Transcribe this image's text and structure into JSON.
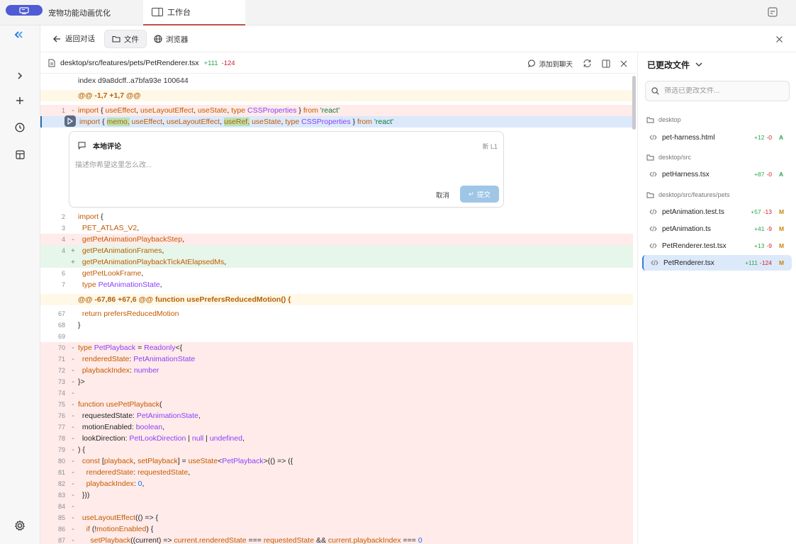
{
  "tabs": [
    {
      "label": "宠物功能动画优化"
    },
    {
      "label": "工作台"
    }
  ],
  "header": {
    "back_label": "返回对话",
    "seg": [
      {
        "label": "文件"
      },
      {
        "label": "浏览器"
      }
    ]
  },
  "file": {
    "path": "desktop/src/features/pets/PetRenderer.tsx",
    "added": "+111",
    "removed": "-124",
    "add_to_chat": "添加到聊天"
  },
  "diff": {
    "index_line": "index d9a8dcff..a7bfa93e 100644",
    "hunk1": "@@ -1,7 +1,7 @@",
    "hunk2": "@@ -67,86 +67,6 @@ function usePrefersReducedMotion() {"
  },
  "comment": {
    "title": "本地评论",
    "line_ref": "新 L1",
    "placeholder": "描述你希望这里怎么改...",
    "cancel": "取消",
    "submit": "提交"
  },
  "changed_files": {
    "title": "已更改文件",
    "search_placeholder": "筛选已更改文件...",
    "groups": [
      {
        "folder": "desktop",
        "files": [
          {
            "name": "pet-harness.html",
            "added": "+12",
            "removed": "-0",
            "status": "A",
            "status_color": "#2da44e"
          }
        ]
      },
      {
        "folder": "desktop/src",
        "files": [
          {
            "name": "petHarness.tsx",
            "added": "+87",
            "removed": "-0",
            "status": "A",
            "status_color": "#2da44e"
          }
        ]
      },
      {
        "folder": "desktop/src/features/pets",
        "files": [
          {
            "name": "petAnimation.test.ts",
            "added": "+57",
            "removed": "-13",
            "status": "M",
            "status_color": "#c9860c"
          },
          {
            "name": "petAnimation.ts",
            "added": "+41",
            "removed": "-9",
            "status": "M",
            "status_color": "#c9860c"
          },
          {
            "name": "PetRenderer.test.tsx",
            "added": "+13",
            "removed": "-9",
            "status": "M",
            "status_color": "#c9860c"
          },
          {
            "name": "PetRenderer.tsx",
            "added": "+111",
            "removed": "-124",
            "status": "M",
            "status_color": "#c9860c"
          }
        ]
      }
    ]
  },
  "colors": {
    "accent": "#4f5bd5",
    "tab_underline": "#c0504d",
    "add_text": "#2da44e",
    "del_text": "#cf222e"
  }
}
